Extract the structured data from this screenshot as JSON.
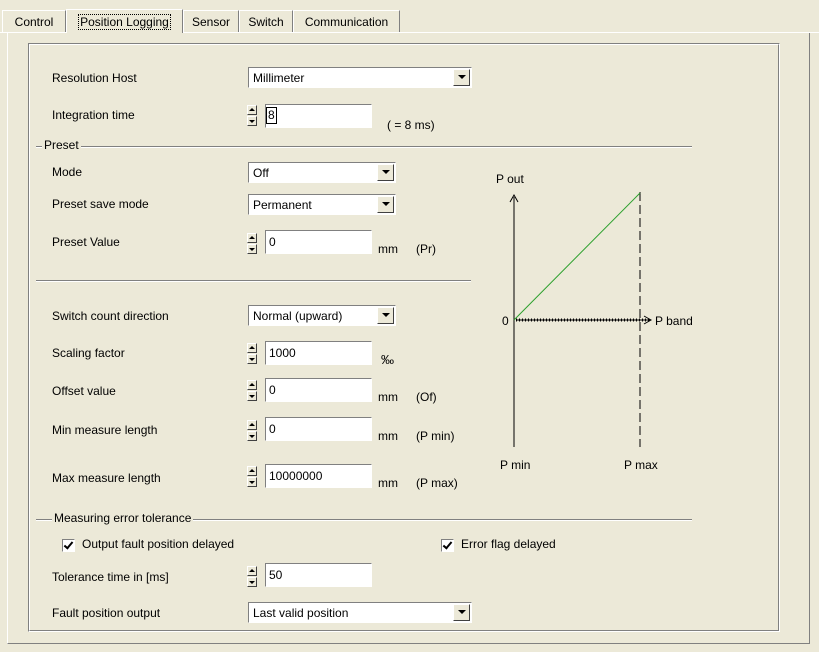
{
  "tabs": [
    "Control",
    "Position Logging",
    "Sensor",
    "Switch",
    "Communication"
  ],
  "fields": {
    "resolution_host": {
      "label": "Resolution Host",
      "value": "Millimeter"
    },
    "integration_time": {
      "label": "Integration time",
      "value": "8",
      "suffix": "( = 8 ms)"
    },
    "preset_section": "Preset",
    "mode": {
      "label": "Mode",
      "value": "Off"
    },
    "preset_save_mode": {
      "label": "Preset save mode",
      "value": "Permanent"
    },
    "preset_value": {
      "label": "Preset Value",
      "value": "0",
      "unit": "mm",
      "tag": "(Pr)"
    },
    "switch_count_direction": {
      "label": "Switch count direction",
      "value": "Normal (upward)"
    },
    "scaling_factor": {
      "label": "Scaling factor",
      "value": "1000",
      "unit": "‰"
    },
    "offset_value": {
      "label": "Offset value",
      "value": "0",
      "unit": "mm",
      "tag": "(Of)"
    },
    "min_measure_length": {
      "label": "Min measure length",
      "value": "0",
      "unit": "mm",
      "tag": "(P min)"
    },
    "max_measure_length": {
      "label": "Max measure length",
      "value": "10000000",
      "unit": "mm",
      "tag": "(P max)"
    },
    "error_section": "Measuring error tolerance",
    "output_fault_delayed": {
      "label": "Output fault position delayed",
      "checked": true
    },
    "error_flag_delayed": {
      "label": "Error flag delayed",
      "checked": true
    },
    "tolerance_time": {
      "label": "Tolerance time in [ms]",
      "value": "50"
    },
    "fault_position_output": {
      "label": "Fault position output",
      "value": "Last valid position"
    }
  },
  "diagram": {
    "p_out": "P out",
    "zero": "0",
    "p_band": "P band",
    "p_min": "P min",
    "p_max": "P max",
    "line_color": "#2ca02c"
  }
}
